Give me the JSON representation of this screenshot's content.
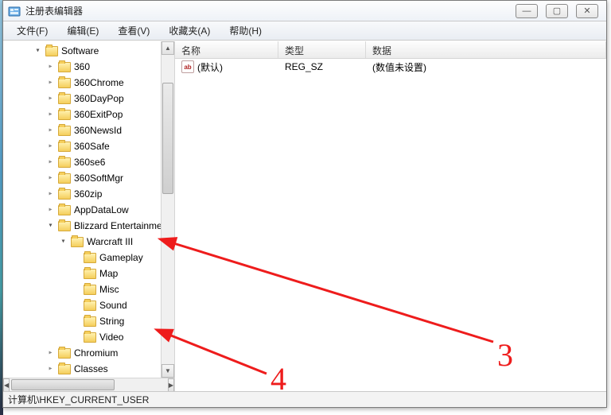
{
  "window": {
    "title": "注册表编辑器"
  },
  "menu": {
    "file": "文件(F)",
    "edit": "编辑(E)",
    "view": "查看(V)",
    "fav": "收藏夹(A)",
    "help": "帮助(H)"
  },
  "tree": {
    "root": "Software",
    "items": [
      "360",
      "360Chrome",
      "360DayPop",
      "360ExitPop",
      "360NewsId",
      "360Safe",
      "360se6",
      "360SoftMgr",
      "360zip",
      "AppDataLow"
    ],
    "blizzard": "Blizzard Entertainment",
    "warcraft": "Warcraft III",
    "warcraft_children": [
      "Gameplay",
      "Map",
      "Misc",
      "Sound",
      "String",
      "Video"
    ],
    "tail": [
      "Chromium",
      "Classes"
    ]
  },
  "columns": {
    "name": "名称",
    "type": "类型",
    "data": "数据"
  },
  "rows": [
    {
      "name": "(默认)",
      "type": "REG_SZ",
      "data": "(数值未设置)"
    }
  ],
  "value_icon_text": "ab",
  "statusbar": "计算机\\HKEY_CURRENT_USER",
  "annotations": {
    "three": "3",
    "four": "4"
  }
}
